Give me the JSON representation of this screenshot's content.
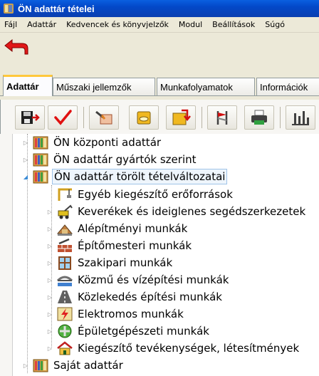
{
  "window": {
    "title": "ÖN adattár tételei"
  },
  "menu": [
    "Fájl",
    "Adattár",
    "Kedvencek és könyvjelzők",
    "Modul",
    "Beállítások",
    "Súgó"
  ],
  "tabs": [
    {
      "label": "Adattár",
      "active": true
    },
    {
      "label": "Műszaki jellemzők",
      "active": false
    },
    {
      "label": "Munkafolyamatok",
      "active": false
    },
    {
      "label": "Információk",
      "active": false
    }
  ],
  "toolbar_buttons": [
    "save-exit-icon",
    "checkmark-icon",
    "edit-item-icon",
    "box-icon",
    "download-to-box-icon",
    "flag-tool-icon",
    "printer-icon",
    "chart-icon"
  ],
  "tree": [
    {
      "label": "ÖN központi adattár",
      "level": 0,
      "expanded": false,
      "icon": "library-icon"
    },
    {
      "label": "ÖN adattár gyártók szerint",
      "level": 0,
      "expanded": false,
      "icon": "library-icon"
    },
    {
      "label": "ÖN adattár törölt tételváltozatai",
      "level": 0,
      "expanded": true,
      "selected": true,
      "icon": "library-icon"
    },
    {
      "label": "Egyéb kiegészítő erőforrások",
      "level": 1,
      "has_children": false,
      "icon": "crane-icon"
    },
    {
      "label": "Keverékek és ideiglenes segédszerkezetek",
      "level": 1,
      "has_children": true,
      "icon": "machinery-icon"
    },
    {
      "label": "Alépítményi munkák",
      "level": 1,
      "has_children": true,
      "icon": "foundation-icon"
    },
    {
      "label": "Építőmesteri munkák",
      "level": 1,
      "has_children": true,
      "icon": "masonry-icon"
    },
    {
      "label": "Szakipari munkák",
      "level": 1,
      "has_children": true,
      "icon": "window-icon"
    },
    {
      "label": "Közmű és vízépítési munkák",
      "level": 1,
      "has_children": true,
      "icon": "bridge-icon"
    },
    {
      "label": "Közlekedés építési munkák",
      "level": 1,
      "has_children": true,
      "icon": "road-icon"
    },
    {
      "label": "Elektromos munkák",
      "level": 1,
      "has_children": true,
      "icon": "lightning-icon"
    },
    {
      "label": "Épületgépészeti munkák",
      "level": 1,
      "has_children": true,
      "icon": "pipe-icon"
    },
    {
      "label": "Kiegészítő tevékenységek, létesítmények",
      "level": 1,
      "has_children": true,
      "icon": "house-icon"
    },
    {
      "label": "Saját adattár",
      "level": 0,
      "expanded": false,
      "icon": "library-icon"
    }
  ],
  "colors": {
    "titlebar": "#0a4fd0",
    "chrome": "#ece9d8",
    "selection_border": "#9fc3e8",
    "active_tab_accent": "#ffc83c"
  }
}
